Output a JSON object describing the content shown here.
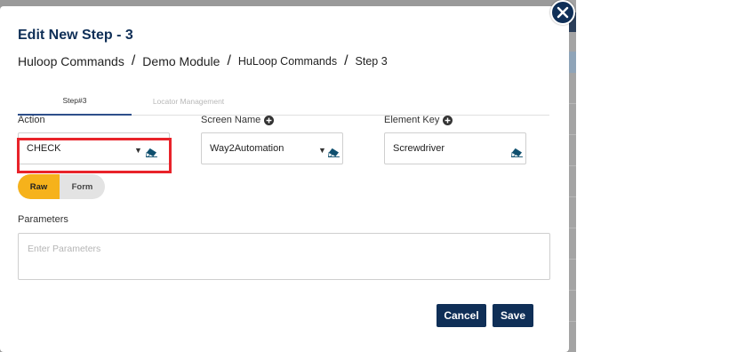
{
  "modal": {
    "title": "Edit New Step - 3"
  },
  "breadcrumb": [
    "Huloop Commands",
    "Demo Module",
    "HuLoop Commands",
    "Step 3"
  ],
  "breadcrumb_separator": "/",
  "tabs": [
    {
      "label": "Step#3",
      "active": true
    },
    {
      "label": "Locator Management",
      "active": false
    }
  ],
  "fields": {
    "action": {
      "label": "Action",
      "value": "CHECK"
    },
    "screen_name": {
      "label": "Screen Name",
      "value": "Way2Automation"
    },
    "element_key": {
      "label": "Element Key",
      "value": "Screwdriver"
    }
  },
  "toggle": {
    "raw_label": "Raw",
    "form_label": "Form",
    "selected": "Raw"
  },
  "parameters": {
    "label": "Parameters",
    "placeholder": "Enter Parameters",
    "value": ""
  },
  "buttons": {
    "cancel_label": "Cancel",
    "save_label": "Save"
  },
  "icons": {
    "caret": "▼",
    "close": "close-icon",
    "add": "plus-circle-icon",
    "clear": "eraser-icon"
  },
  "colors": {
    "navy": "#0f2f57",
    "accent_yellow": "#f6b21b",
    "highlight_red": "#e8232a",
    "eraser_teal": "#0f4f6e"
  }
}
